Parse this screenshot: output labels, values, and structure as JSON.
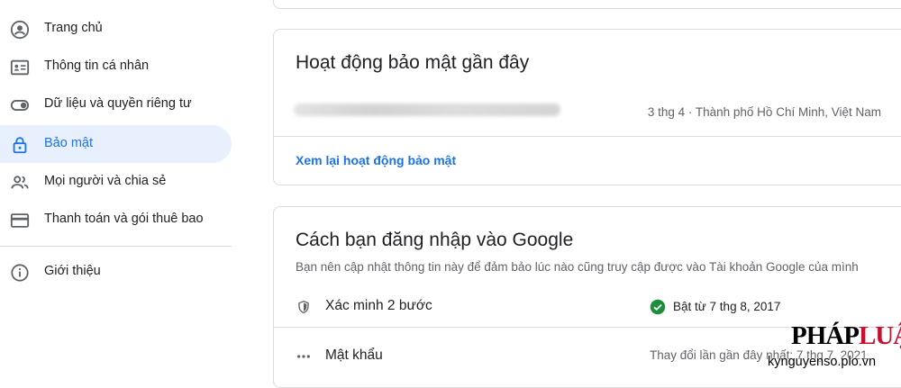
{
  "sidebar": {
    "items": [
      {
        "label": "Trang chủ",
        "icon": "account-circle-icon"
      },
      {
        "label": "Thông tin cá nhân",
        "icon": "id-card-icon"
      },
      {
        "label": "Dữ liệu và quyền riêng tư",
        "icon": "toggle-icon"
      },
      {
        "label": "Bảo mật",
        "icon": "lock-icon",
        "active": true
      },
      {
        "label": "Mọi người và chia sẻ",
        "icon": "people-icon"
      },
      {
        "label": "Thanh toán và gói thuê bao",
        "icon": "credit-card-icon"
      },
      {
        "label": "Giới thiệu",
        "icon": "info-icon"
      }
    ]
  },
  "security_activity": {
    "title": "Hoạt động bảo mật gần đây",
    "item_meta": "3 thg 4 · Thành phố Hồ Chí Minh, Việt Nam",
    "review_link": "Xem lại hoạt động bảo mật"
  },
  "signin": {
    "title": "Cách bạn đăng nhập vào Google",
    "subtitle": "Bạn nên cập nhật thông tin này để đảm bảo lúc nào cũng truy cập được vào Tài khoản Google của mình",
    "two_step": {
      "label": "Xác minh 2 bước",
      "status": "Bật từ 7 thg 8, 2017",
      "icon": "shield-icon",
      "status_icon": "check-circle-icon"
    },
    "password": {
      "label": "Mật khẩu",
      "status": "Thay đổi lần gần đây nhất: 7 thg 7, 2021",
      "icon": "password-dots-icon"
    }
  },
  "watermark": {
    "logo_a": "PHÁP",
    "logo_b": "LUẬT",
    "url": "kynguyenso.plo.vn"
  },
  "colors": {
    "accent": "#1a73e8",
    "active_bg": "#e8f0fe",
    "success": "#1e8e3e",
    "divider": "#dadce0",
    "brand_red": "#c8102e"
  }
}
